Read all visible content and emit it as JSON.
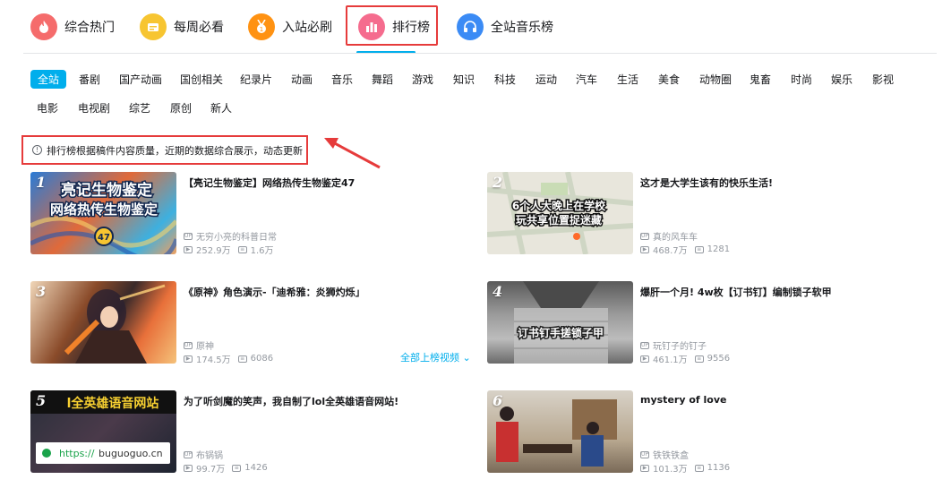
{
  "topnav": {
    "items": [
      {
        "label": "综合热门",
        "icon": "fire-icon",
        "color": "#f56c6c"
      },
      {
        "label": "每周必看",
        "icon": "calendar-icon",
        "color": "#f7c531"
      },
      {
        "label": "入站必刷",
        "icon": "medal-icon",
        "color": "#ff9212"
      },
      {
        "label": "排行榜",
        "icon": "bar-chart-icon",
        "color": "#f56c8e"
      },
      {
        "label": "全站音乐榜",
        "icon": "headphones-icon",
        "color": "#3b8bf5"
      }
    ],
    "active_index": 3
  },
  "categories": [
    "全站",
    "番剧",
    "国产动画",
    "国创相关",
    "纪录片",
    "动画",
    "音乐",
    "舞蹈",
    "游戏",
    "知识",
    "科技",
    "运动",
    "汽车",
    "生活",
    "美食",
    "动物圈",
    "鬼畜",
    "时尚",
    "娱乐",
    "影视",
    "电影",
    "电视剧",
    "综艺",
    "原创",
    "新人"
  ],
  "notice": {
    "icon": "①",
    "text": "排行榜根据稿件内容质量，近期的数据综合展示，动态更新"
  },
  "videos": [
    {
      "rank": "1",
      "title": "【亮记生物鉴定】网络热传生物鉴定47",
      "up": "无穷小亮的科普日常",
      "views": "252.9万",
      "danmaku": "1.6万",
      "thumb_text": "亮记生物鉴定\n网络热传生物鉴定"
    },
    {
      "rank": "2",
      "title": "这才是大学生该有的快乐生活!",
      "up": "真的风车车",
      "views": "468.7万",
      "danmaku": "1281",
      "thumb_text": "6个人大晚上在学校\n玩共享位置捉迷藏"
    },
    {
      "rank": "3",
      "title": "《原神》角色演示-「迪希雅：炎狮灼烁」",
      "up": "原神",
      "views": "174.5万",
      "danmaku": "6086",
      "thumb_text": ""
    },
    {
      "rank": "4",
      "title": "爆肝一个月! 4w枚【订书钉】编制锁子软甲",
      "up": "玩钉子的钉子",
      "views": "461.1万",
      "danmaku": "9556",
      "thumb_text": "订书钉手搓锁子甲"
    },
    {
      "rank": "5",
      "title": "为了听剑魔的笑声，我自制了lol全英雄语音网站!",
      "up": "布锅锅",
      "views": "99.7万",
      "danmaku": "1426",
      "thumb_text": "lol全英雄语音网站",
      "thumb_url": "https://buguoguo.cn"
    },
    {
      "rank": "6",
      "title": "mystery of love",
      "up": "铁铁铁盒",
      "views": "101.3万",
      "danmaku": "1136",
      "thumb_text": ""
    }
  ],
  "all_videos_link": "全部上榜视频 ⌄",
  "colors": {
    "accent": "#00aeec",
    "highlight_box": "#e63b3b"
  }
}
